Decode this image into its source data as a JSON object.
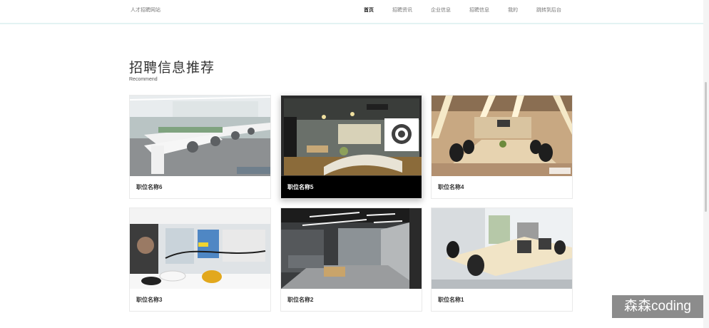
{
  "site": {
    "name": "人才招聘网站"
  },
  "nav": {
    "items": [
      {
        "label": "首页",
        "active": true
      },
      {
        "label": "招聘资讯",
        "active": false
      },
      {
        "label": "企业信息",
        "active": false
      },
      {
        "label": "招聘信息",
        "active": false
      },
      {
        "label": "我的",
        "active": false
      },
      {
        "label": "跳转到后台",
        "active": false
      }
    ]
  },
  "section": {
    "title": "招聘信息推荐",
    "subtitle": "Recommend"
  },
  "cards": [
    {
      "name": "职位名称6"
    },
    {
      "name": "职位名称5"
    },
    {
      "name": "职位名称4"
    },
    {
      "name": "职位名称3"
    },
    {
      "name": "职位名称2"
    },
    {
      "name": "职位名称1"
    }
  ],
  "watermark": "森森coding"
}
